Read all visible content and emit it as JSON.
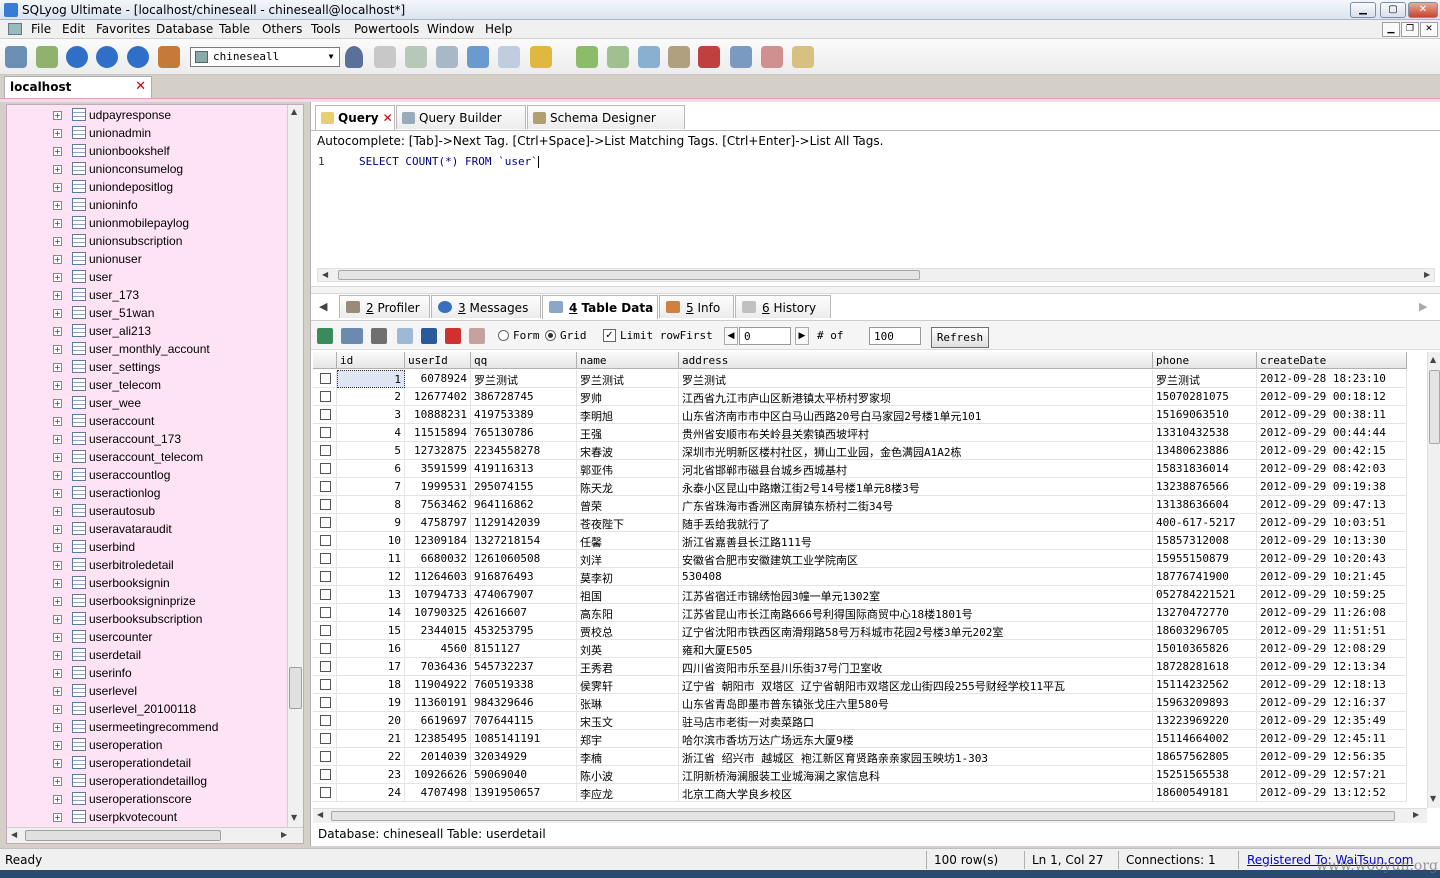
{
  "window": {
    "title": "SQLyog Ultimate - [localhost/chineseall - chineseall@localhost*]"
  },
  "menu": [
    "File",
    "Edit",
    "Favorites",
    "Database",
    "Table",
    "Others",
    "Tools",
    "Powertools",
    "Window",
    "Help"
  ],
  "toolbar": {
    "database_selected": "chineseall"
  },
  "connection_tab": {
    "label": "localhost",
    "close": "✕"
  },
  "object_browser": {
    "tables": [
      "udpayresponse",
      "unionadmin",
      "unionbookshelf",
      "unionconsumelog",
      "uniondepositlog",
      "unioninfo",
      "unionmobilepaylog",
      "unionsubscription",
      "unionuser",
      "user",
      "user_173",
      "user_51wan",
      "user_ali213",
      "user_monthly_account",
      "user_settings",
      "user_telecom",
      "user_wee",
      "useraccount",
      "useraccount_173",
      "useraccount_telecom",
      "useraccountlog",
      "useractionlog",
      "userautosub",
      "useravataraudit",
      "userbind",
      "userbitroledetail",
      "userbooksignin",
      "userbooksigninprize",
      "userbooksubscription",
      "usercounter",
      "userdetail",
      "userinfo",
      "userlevel",
      "userlevel_20100118",
      "usermeetingrecommend",
      "useroperation",
      "useroperationdetail",
      "useroperationdetaillog",
      "useroperationscore",
      "userpkvotecount"
    ]
  },
  "query_tabs": [
    {
      "label": "Query",
      "close": "✕"
    },
    {
      "label": "Query Builder"
    },
    {
      "label": "Schema Designer"
    }
  ],
  "editor": {
    "autocomplete_hint": "Autocomplete: [Tab]->Next Tag. [Ctrl+Space]->List Matching Tags. [Ctrl+Enter]->List All Tags.",
    "line_number": "1",
    "sql": "SELECT COUNT(*) FROM `user`"
  },
  "result_tabs": [
    {
      "num": "2",
      "label": "Profiler"
    },
    {
      "num": "3",
      "label": "Messages"
    },
    {
      "num": "4",
      "label": "Table Data"
    },
    {
      "num": "5",
      "label": "Info"
    },
    {
      "num": "6",
      "label": "History"
    }
  ],
  "result_toolbar": {
    "form_label": "Form",
    "grid_label": "Grid",
    "limit_label": "Limit rowFirst",
    "first_row": "0",
    "of_label": "# of",
    "row_count": "100",
    "refresh_label": "Refresh"
  },
  "grid": {
    "columns": [
      "id",
      "userId",
      "qq",
      "name",
      "address",
      "phone",
      "createDate"
    ],
    "rows": [
      [
        "1",
        "6078924",
        "罗兰测试",
        "罗兰测试",
        "罗兰测试",
        "罗兰测试",
        "2012-09-28 18:23:10"
      ],
      [
        "2",
        "12677402",
        "386728745",
        "罗帅",
        "江西省九江市庐山区新港镇太平桥村罗家坝",
        "15070281075",
        "2012-09-29 00:18:12"
      ],
      [
        "3",
        "10888231",
        "419753389",
        "李明旭",
        "山东省济南市市中区白马山西路20号白马家园2号楼1单元101",
        "15169063510",
        "2012-09-29 00:38:11"
      ],
      [
        "4",
        "11515894",
        "765130786",
        "王强",
        "贵州省安顺市布关岭县关索镇西坡坪村",
        "13310432538",
        "2012-09-29 00:44:44"
      ],
      [
        "5",
        "12732875",
        "2234558278",
        "宋春波",
        "深圳市光明新区楼村社区，狮山工业园，金色满园A1A2栋",
        "13480623886",
        "2012-09-29 00:42:15"
      ],
      [
        "6",
        "3591599",
        "419116313",
        "郭亚伟",
        "河北省邯郸市磁县台城乡西城基村",
        "15831836014",
        "2012-09-29 08:42:03"
      ],
      [
        "7",
        "1999531",
        "295074155",
        "陈天龙",
        "永泰小区昆山中路嫩江街2号14号楼1单元8楼3号",
        "13238876566",
        "2012-09-29 09:19:38"
      ],
      [
        "8",
        "7563462",
        "964116862",
        "曾荣",
        "广东省珠海市香洲区南屏镇东桥村二街34号",
        "13138636604",
        "2012-09-29 09:47:13"
      ],
      [
        "9",
        "4758797",
        "1129142039",
        "苍夜陛下",
        "随手丢给我就行了",
        "400-617-5217",
        "2012-09-29 10:03:51"
      ],
      [
        "10",
        "12309184",
        "1327218154",
        "任馨",
        "浙江省嘉善县长江路111号",
        "15857312008",
        "2012-09-29 10:13:30"
      ],
      [
        "11",
        "6680032",
        "1261060508",
        "刘洋",
        "安徽省合肥市安徽建筑工业学院南区",
        "15955150879",
        "2012-09-29 10:20:43"
      ],
      [
        "12",
        "11264603",
        "916876493",
        "莫李初",
        "530408",
        "18776741900",
        "2012-09-29 10:21:45"
      ],
      [
        "13",
        "10794733",
        "474067907",
        "祖国",
        "江苏省宿迁市锦绣怡园3幢一单元1302室",
        "052784221521",
        "2012-09-29 10:59:25"
      ],
      [
        "14",
        "10790325",
        "42616607",
        "高东阳",
        "江苏省昆山市长江南路666号利得国际商贸中心18楼1801号",
        "13270472770",
        "2012-09-29 11:26:08"
      ],
      [
        "15",
        "2344015",
        "453253795",
        "贾校总",
        "辽宁省沈阳市铁西区南滑翔路58号万科城市花园2号楼3单元202室",
        "18603296705",
        "2012-09-29 11:51:51"
      ],
      [
        "16",
        "4560",
        "8151127",
        "刘英",
        "雍和大厦E505",
        "15010365826",
        "2012-09-29 12:08:29"
      ],
      [
        "17",
        "7036436",
        "545732237",
        "王秀君",
        "四川省资阳市乐至县川乐街37号门卫室收",
        "18728281618",
        "2012-09-29 12:13:34"
      ],
      [
        "18",
        "11904922",
        "760519338",
        "侯霁轩",
        "辽宁省 朝阳市 双塔区 辽宁省朝阳市双塔区龙山街四段255号财经学校11平瓦",
        "15114232562",
        "2012-09-29 12:18:13"
      ],
      [
        "19",
        "11360191",
        "984329646",
        "张琳",
        "山东省青岛即墨市普东镇张戈庄六里580号",
        "15963209893",
        "2012-09-29 12:16:37"
      ],
      [
        "20",
        "6619697",
        "707644115",
        "宋玉文",
        "驻马店市老街一对卖菜路口",
        "13223969220",
        "2012-09-29 12:35:49"
      ],
      [
        "21",
        "12385495",
        "1085141191",
        "郑宇",
        "哈尔滨市香坊万达广场远东大厦9楼",
        "15114664002",
        "2012-09-29 12:45:11"
      ],
      [
        "22",
        "2014039",
        "32034929",
        "李楠",
        "浙江省 绍兴市 越城区 袍江新区育贤路亲亲家园玉映坊1-303",
        "18657562805",
        "2012-09-29 12:56:35"
      ],
      [
        "23",
        "10926626",
        "59069040",
        "陈小波",
        "江阴新桥海澜服装工业城海澜之家信息科",
        "15251565538",
        "2012-09-29 12:57:21"
      ],
      [
        "24",
        "4707498",
        "1391950657",
        "李应龙",
        "北京工商大学良乡校区",
        "18600549181",
        "2012-09-29 13:12:52"
      ]
    ]
  },
  "info_line": "Database: chineseall  Table: userdetail",
  "status": {
    "ready": "Ready",
    "rows": "100 row(s)",
    "position": "Ln 1, Col 27",
    "connections": "Connections: 1",
    "registered": "Registered To: WaiTsun.com"
  },
  "watermark": "www.wooyun.org"
}
